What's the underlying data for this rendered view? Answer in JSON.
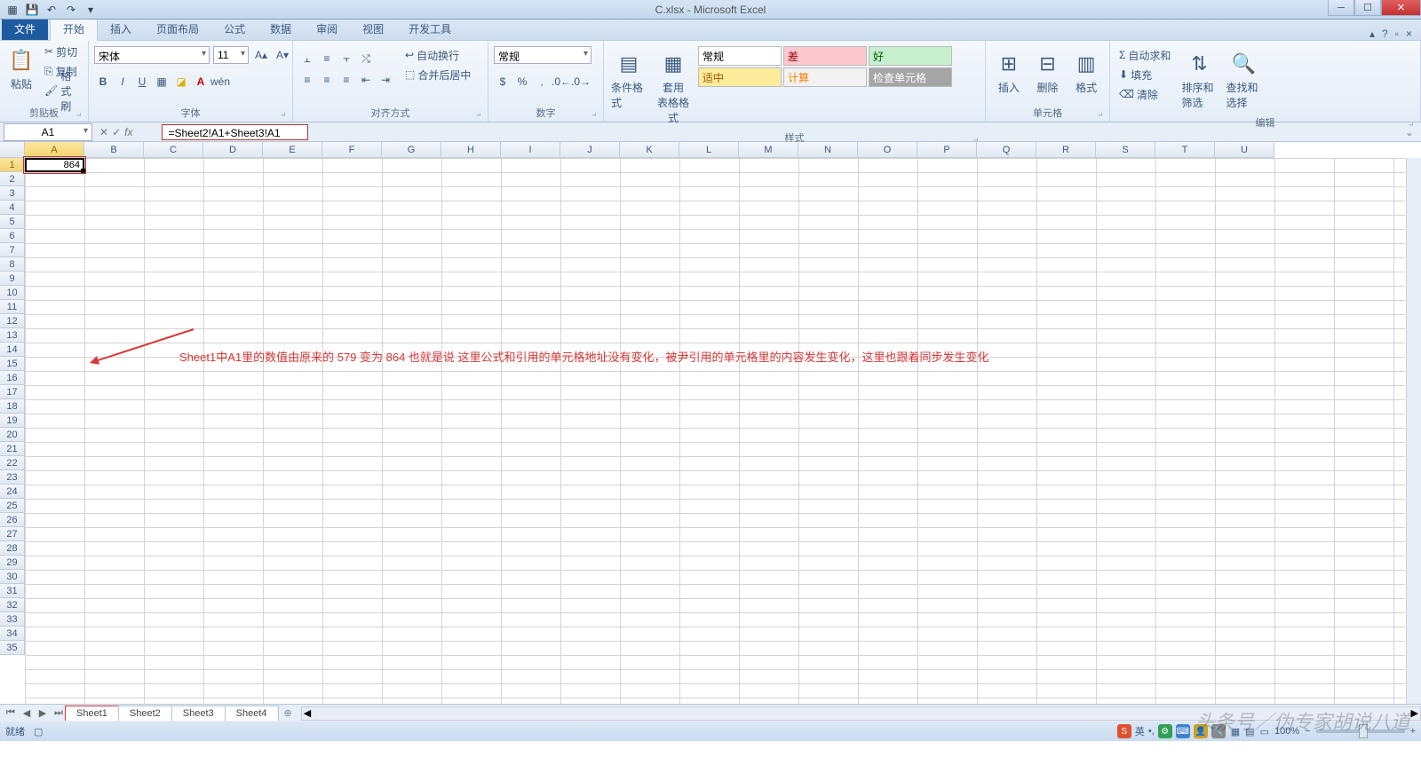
{
  "title": "C.xlsx - Microsoft Excel",
  "tabs": {
    "file": "文件",
    "items": [
      "开始",
      "插入",
      "页面布局",
      "公式",
      "数据",
      "审阅",
      "视图",
      "开发工具"
    ],
    "activeIndex": 0
  },
  "clipboard": {
    "label": "剪贴板",
    "paste": "粘贴",
    "cut": "剪切",
    "copy": "复制",
    "painter": "格式刷"
  },
  "font": {
    "label": "字体",
    "name": "宋体",
    "size": "11"
  },
  "align": {
    "label": "对齐方式",
    "wrap": "自动换行",
    "merge": "合并后居中"
  },
  "number": {
    "label": "数字",
    "format": "常规"
  },
  "styles": {
    "label": "样式",
    "cond": "条件格式",
    "tablefmt": "套用\n表格格式",
    "cells": [
      {
        "t": "常规",
        "bg": "#ffffff",
        "c": "#000"
      },
      {
        "t": "差",
        "bg": "#ffc7ce",
        "c": "#9c0006"
      },
      {
        "t": "好",
        "bg": "#c6efce",
        "c": "#006100"
      },
      {
        "t": "适中",
        "bg": "#ffeb9c",
        "c": "#9c5700"
      },
      {
        "t": "计算",
        "bg": "#f2f2f2",
        "c": "#fa7d00"
      },
      {
        "t": "检查单元格",
        "bg": "#a5a5a5",
        "c": "#ffffff"
      }
    ]
  },
  "cells": {
    "label": "单元格",
    "insert": "插入",
    "delete": "删除",
    "format": "格式"
  },
  "editing": {
    "label": "编辑",
    "autosum": "自动求和",
    "fill": "填充",
    "clear": "清除",
    "sort": "排序和筛选",
    "find": "查找和选择"
  },
  "namebox": "A1",
  "formula": "=Sheet2!A1+Sheet3!A1",
  "cellValue": "864",
  "columns": [
    "A",
    "B",
    "C",
    "D",
    "E",
    "F",
    "G",
    "H",
    "I",
    "J",
    "K",
    "L",
    "M",
    "N",
    "O",
    "P",
    "Q",
    "R",
    "S",
    "T",
    "U"
  ],
  "rowCount": 35,
  "annotation": "Sheet1中A1里的数值由原来的 579  变为  864  也就是说 这里公式和引用的单元格地址没有变化，被尹引用的单元格里的内容发生变化，这里也跟着同步发生变化",
  "sheetTabs": [
    "Sheet1",
    "Sheet2",
    "Sheet3",
    "Sheet4"
  ],
  "activeSheet": 0,
  "status": {
    "ready": "就绪",
    "zoom": "100%",
    "ime": "英"
  },
  "watermark": "头条号／伪专家胡说八道"
}
